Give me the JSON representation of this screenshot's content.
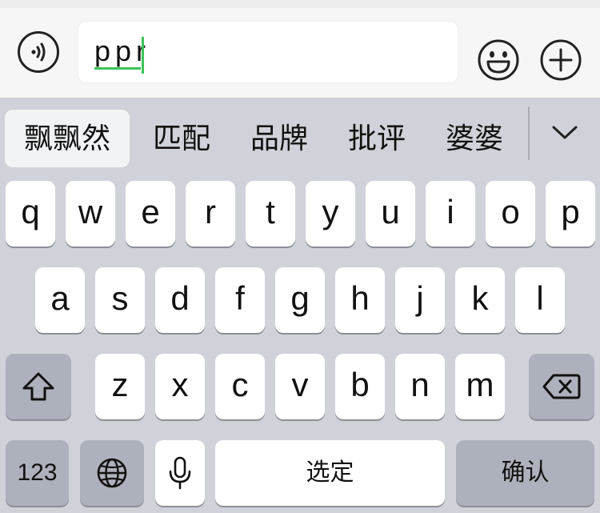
{
  "input": {
    "composing_text": "ppr"
  },
  "icons": {
    "voice": "voice-wave-icon",
    "emoji": "smiley-face-icon",
    "plus": "plus-circle-icon",
    "expand": "chevron-down-icon",
    "shift": "shift-arrow-icon",
    "backspace": "backspace-icon",
    "globe": "globe-icon",
    "mic": "microphone-icon"
  },
  "candidates": [
    {
      "label": "飘飘然",
      "selected": true
    },
    {
      "label": "匹配"
    },
    {
      "label": "品牌"
    },
    {
      "label": "批评"
    },
    {
      "label": "婆婆"
    }
  ],
  "keyboard": {
    "row1": [
      "q",
      "w",
      "e",
      "r",
      "t",
      "y",
      "u",
      "i",
      "o",
      "p"
    ],
    "row2": [
      "a",
      "s",
      "d",
      "f",
      "g",
      "h",
      "j",
      "k",
      "l"
    ],
    "row3": [
      "z",
      "x",
      "c",
      "v",
      "b",
      "n",
      "m"
    ],
    "numbers_label": "123",
    "space_label": "选定",
    "confirm_label": "确认"
  },
  "colors": {
    "accent_green": "#3cc35a",
    "keyboard_bg": "#cfd2d9",
    "dark_key": "#adb1bb"
  }
}
